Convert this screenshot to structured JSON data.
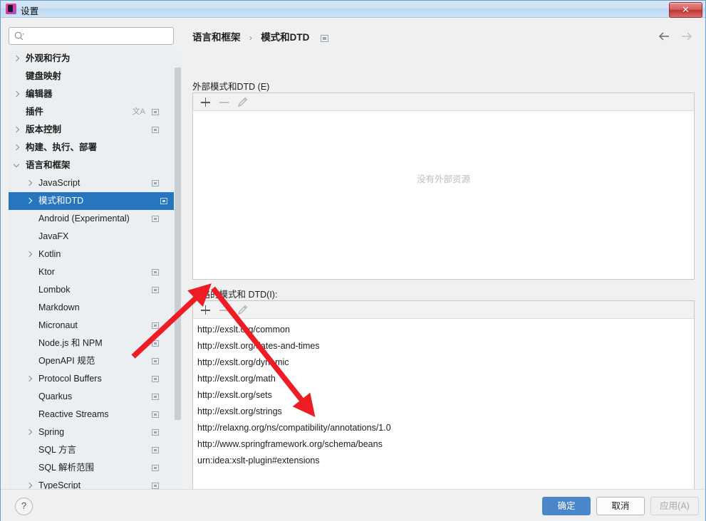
{
  "window": {
    "title": "设置",
    "app_icon": "intellij-idea-icon",
    "close_label": "✕"
  },
  "sidebar": {
    "search": {
      "value": "",
      "placeholder": "",
      "icon": "search-icon"
    },
    "items": [
      {
        "label": "外观和行为",
        "depth": 0,
        "bold": true,
        "chevron": "closed",
        "icon": false
      },
      {
        "label": "键盘映射",
        "depth": 0,
        "bold": true,
        "chevron": "none",
        "icon": false
      },
      {
        "label": "编辑器",
        "depth": 0,
        "bold": true,
        "chevron": "closed",
        "icon": false
      },
      {
        "label": "插件",
        "depth": 0,
        "bold": true,
        "chevron": "none",
        "icon": true,
        "translate_icon": "文A"
      },
      {
        "label": "版本控制",
        "depth": 0,
        "bold": true,
        "chevron": "closed",
        "icon": true
      },
      {
        "label": "构建、执行、部署",
        "depth": 0,
        "bold": true,
        "chevron": "closed",
        "icon": false
      },
      {
        "label": "语言和框架",
        "depth": 0,
        "bold": true,
        "chevron": "open",
        "icon": false
      },
      {
        "label": "JavaScript",
        "depth": 1,
        "bold": false,
        "chevron": "closed",
        "icon": true
      },
      {
        "label": "模式和DTD",
        "depth": 1,
        "bold": false,
        "chevron": "closed",
        "icon": true,
        "selected": true
      },
      {
        "label": "Android (Experimental)",
        "depth": 1,
        "bold": false,
        "chevron": "none",
        "icon": true
      },
      {
        "label": "JavaFX",
        "depth": 1,
        "bold": false,
        "chevron": "none",
        "icon": false
      },
      {
        "label": "Kotlin",
        "depth": 1,
        "bold": false,
        "chevron": "closed",
        "icon": false
      },
      {
        "label": "Ktor",
        "depth": 1,
        "bold": false,
        "chevron": "none",
        "icon": true
      },
      {
        "label": "Lombok",
        "depth": 1,
        "bold": false,
        "chevron": "none",
        "icon": true
      },
      {
        "label": "Markdown",
        "depth": 1,
        "bold": false,
        "chevron": "none",
        "icon": false
      },
      {
        "label": "Micronaut",
        "depth": 1,
        "bold": false,
        "chevron": "none",
        "icon": true
      },
      {
        "label": "Node.js 和 NPM",
        "depth": 1,
        "bold": false,
        "chevron": "none",
        "icon": true
      },
      {
        "label": "OpenAPI 规范",
        "depth": 1,
        "bold": false,
        "chevron": "none",
        "icon": true
      },
      {
        "label": "Protocol Buffers",
        "depth": 1,
        "bold": false,
        "chevron": "closed",
        "icon": true
      },
      {
        "label": "Quarkus",
        "depth": 1,
        "bold": false,
        "chevron": "none",
        "icon": true
      },
      {
        "label": "Reactive Streams",
        "depth": 1,
        "bold": false,
        "chevron": "none",
        "icon": true
      },
      {
        "label": "Spring",
        "depth": 1,
        "bold": false,
        "chevron": "closed",
        "icon": true
      },
      {
        "label": "SQL 方言",
        "depth": 1,
        "bold": false,
        "chevron": "none",
        "icon": true
      },
      {
        "label": "SQL 解析范围",
        "depth": 1,
        "bold": false,
        "chevron": "none",
        "icon": true
      },
      {
        "label": "TypeScript",
        "depth": 1,
        "bold": false,
        "chevron": "closed",
        "icon": true
      }
    ]
  },
  "header": {
    "breadcrumb_parent": "语言和框架",
    "breadcrumb_separator": "›",
    "breadcrumb_current": "模式和DTD",
    "breadcrumb_icon": "project-scope-icon",
    "nav_back_icon": "arrow-left-icon",
    "nav_forward_icon": "arrow-right-icon"
  },
  "external_section": {
    "label": "外部模式和DTD (E)",
    "toolbar": {
      "add_icon": "plus-icon",
      "remove_icon": "minus-icon",
      "edit_icon": "pencil-icon"
    },
    "empty_text": "没有外部资源"
  },
  "ignored_section": {
    "label": "忽略的模式和 DTD(I):",
    "toolbar": {
      "add_icon": "plus-icon",
      "remove_icon": "minus-icon",
      "edit_icon": "pencil-icon"
    },
    "items": [
      "http://exslt.org/common",
      "http://exslt.org/dates-and-times",
      "http://exslt.org/dynamic",
      "http://exslt.org/math",
      "http://exslt.org/sets",
      "http://exslt.org/strings",
      "http://relaxng.org/ns/compatibility/annotations/1.0",
      "http://www.springframework.org/schema/beans",
      "urn:idea:xslt-plugin#extensions"
    ]
  },
  "footer": {
    "help_label": "?",
    "ok_label": "确定",
    "cancel_label": "取消",
    "apply_label": "应用(A)"
  },
  "annotations": {
    "arrow_color": "#ee1c25",
    "arrow_1_target": "add-ignored-button",
    "arrow_2_target": "springframework-beans-url"
  }
}
